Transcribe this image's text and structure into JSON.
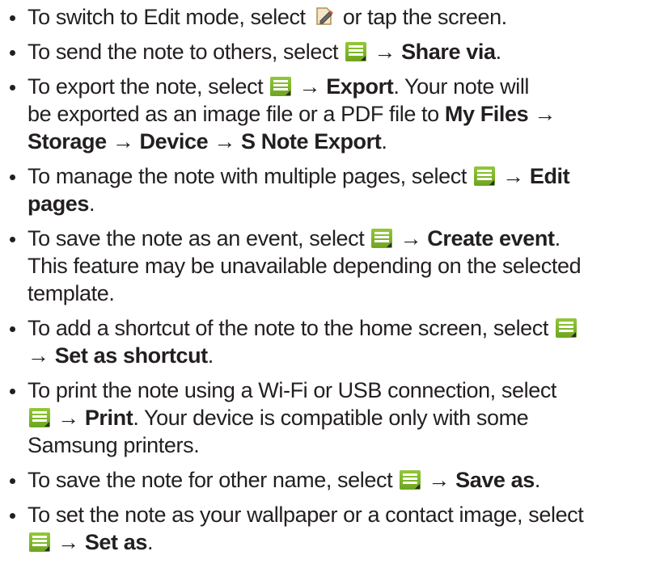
{
  "icons": {
    "menu": "menu-icon",
    "edit": "edit-mode-icon",
    "menu_color": "#7db52a"
  },
  "items": [
    {
      "before": "To switch to Edit mode, select ",
      "after": " or tap the screen."
    },
    {
      "before": "To send the note to others, select ",
      "arrow": " → ",
      "action": "Share via",
      "after": "."
    },
    {
      "before": "To export the note, select ",
      "arrow": " → ",
      "action": "Export",
      "after": ". Your note will",
      "line2_a": "be exported as an image file or a PDF file to ",
      "path1": "My Files",
      "arrow2": " →",
      "path2": "Storage",
      "arrow3": " → ",
      "path3": "Device",
      "arrow4": " → ",
      "path4": "S Note Export",
      "end": "."
    },
    {
      "before": "To manage the note with multiple pages, select ",
      "arrow": " → ",
      "action_a": "Edit",
      "action_b": "pages",
      "after": "."
    },
    {
      "before": "To save the note as an event, select ",
      "arrow": " → ",
      "action": "Create event",
      "after": ".",
      "line2": "This feature may be unavailable depending on the selected",
      "line3": "template."
    },
    {
      "before": "To add a shortcut of the note to the home screen, select ",
      "arrow": "→ ",
      "action": "Set as shortcut",
      "after": "."
    },
    {
      "before": "To print the note using a Wi-Fi or USB connection, select",
      "arrow": " → ",
      "action": "Print",
      "after": ". Your device is compatible only with some",
      "line3": "Samsung printers."
    },
    {
      "before": "To save the note for other name, select ",
      "arrow": " → ",
      "action": "Save as",
      "after": "."
    },
    {
      "before": "To set the note as your wallpaper or a contact image, select",
      "arrow": " → ",
      "action": "Set as",
      "after": "."
    }
  ]
}
